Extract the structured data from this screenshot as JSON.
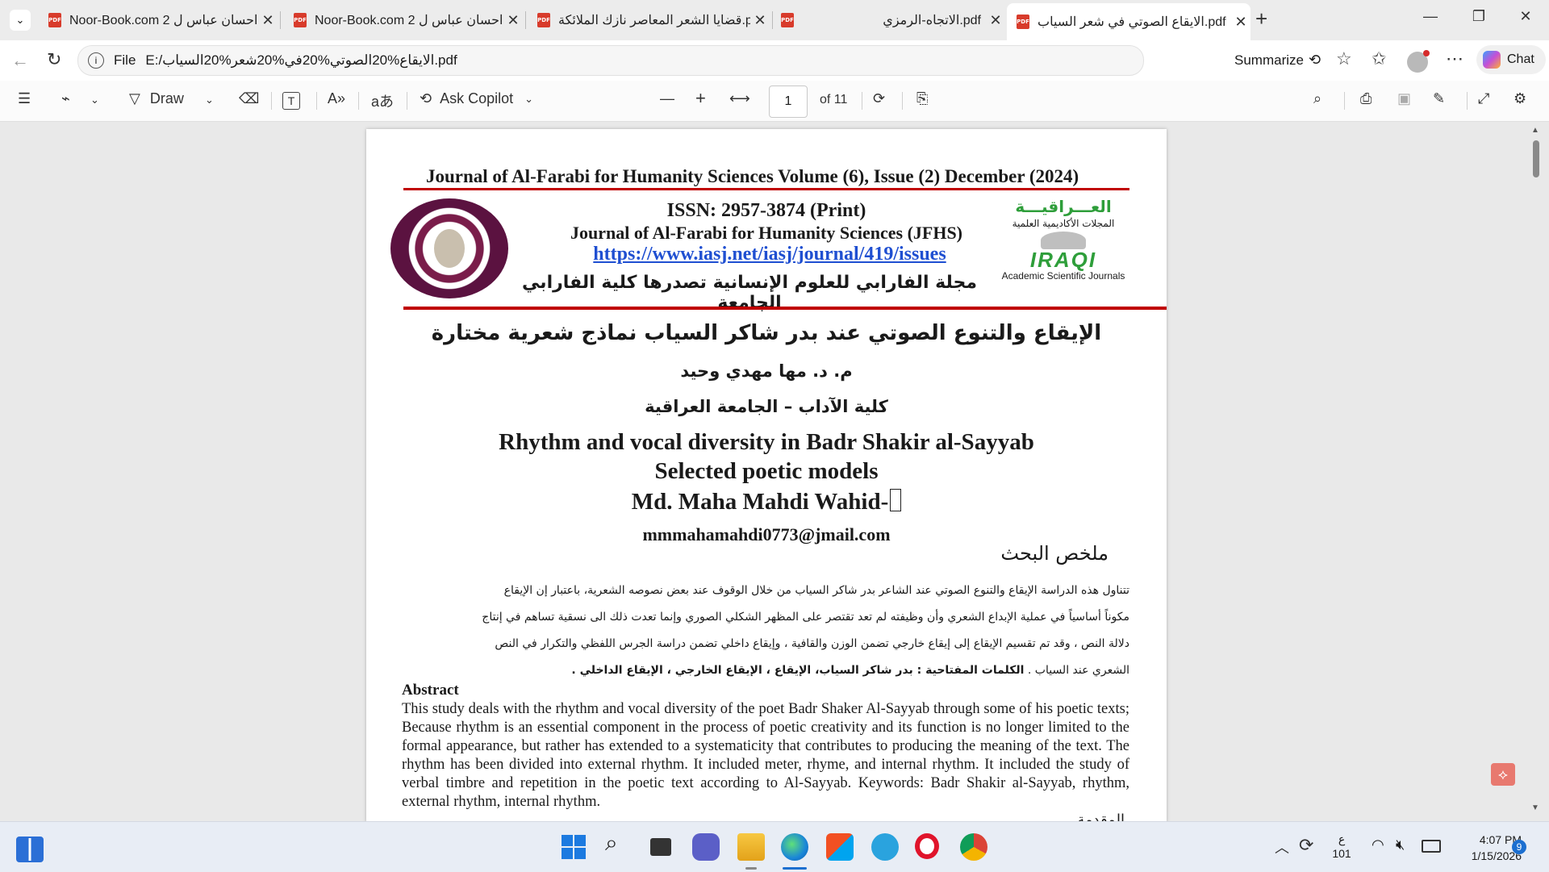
{
  "tabs": [
    {
      "title": "Noor-Book.com 2 احسان عباس ل"
    },
    {
      "title": "Noor-Book.com 2 احسان عباس ل"
    },
    {
      "title": "قضايا الشعر المعاصر نازك الملائكة.pdf"
    },
    {
      "title": "الاتجاه-الرمزي.pdf"
    },
    {
      "title": "الايقاع الصوتي في شعر السياب.pdf"
    }
  ],
  "address": {
    "prefix": "File",
    "url": "E:/الايقاع%20الصوتي%20في%20شعر%20السياب.pdf"
  },
  "browser": {
    "summarize": "Summarize",
    "chat": "Chat"
  },
  "toolbar": {
    "draw": "Draw",
    "ask_copilot": "Ask Copilot",
    "page": "1",
    "of_pages": "of 11"
  },
  "doc": {
    "journal_line": "Journal of Al-Farabi for Humanity Sciences Volume (6), Issue (2) December (2024)",
    "issn": "ISSN: 2957-3874 (Print)",
    "journal_name": "Journal of Al-Farabi for Humanity Sciences (JFHS)",
    "url": "https://www.iasj.net/iasj/journal/419/issues",
    "arabic_journal": "مجلة الفارابي للعلوم الإنسانية تصدرها كلية الفارابي الجامعة",
    "iraqi_ar": "العـــراقيـــة",
    "iraqi_sub": "المجلات الأكاديمية العلمية",
    "iraqi_logo": "IRAQI",
    "iraqi_en": "Academic Scientific Journals",
    "ar_title": "الإيقاع والتنوع الصوتي عند بدر شاكر السياب نماذج شعرية مختارة",
    "ar_author": "م. د. مها مهدي وحيد",
    "ar_college": "كلية الآداب – الجامعة العراقية",
    "en_title_1": "Rhythm and vocal diversity in Badr Shakir al-Sayyab",
    "en_title_2": "Selected poetic models",
    "en_author": "Md. Maha Mahdi Wahid-",
    "email": "mmmahamahdi0773@jmail.com",
    "ar_abstract_head": "ملخص البحث",
    "ar_abstract_1": "تتناول هذه الدراسة الإيقاع والتنوع الصوتي عند الشاعر بدر شاكر السياب من خلال الوقوف عند بعض نصوصه الشعرية، باعتبار إن الإيقاع",
    "ar_abstract_2": "مكوناً أساسياً في عملية الإبداع الشعري وأن وظيفته لم تعد تقتصر على المظهر الشكلي الصوري وإنما تعدت ذلك الى نسقية تساهم في إنتاج",
    "ar_abstract_3": "دلالة النص ، وقد تم تقسيم الإيقاع إلى إيقاع خارجي تضمن الوزن والقافية ، وإيقاع داخلي تضمن دراسة الجرس اللفظي والتكرار في النص",
    "ar_abstract_4a": "الشعري عند السياب .",
    "ar_abstract_4b": "الكلمات المفتاحية : بدر شاكر السياب، الإيقاع ، الإيقاع الخارجي ، الإيقاع الداخلي .",
    "abstract_head": "Abstract",
    "abstract_text": "This study deals with the rhythm and vocal diversity of the poet Badr Shaker Al-Sayyab through some of his poetic texts; Because rhythm is an essential component in the process of poetic creativity and its function is no longer limited to the formal appearance, but rather has extended to a systematicity that contributes to producing the meaning of the text. The rhythm has been divided into external rhythm. It included meter, rhyme, and internal rhythm. It included the study of verbal timbre and repetition in the poetic text according to Al-Sayyab. Keywords: Badr Shakir al-Sayyab, rhythm, external rhythm, internal rhythm.",
    "cut_text": "المقدمة"
  },
  "tray": {
    "lang_top": "ع",
    "lang_bottom": "101",
    "time": "4:07 PM",
    "date": "1/15/2026",
    "badge": "9"
  },
  "colors": {
    "red_rule": "#c00000",
    "link": "#1f4fd1",
    "green": "#2e9e3a"
  }
}
